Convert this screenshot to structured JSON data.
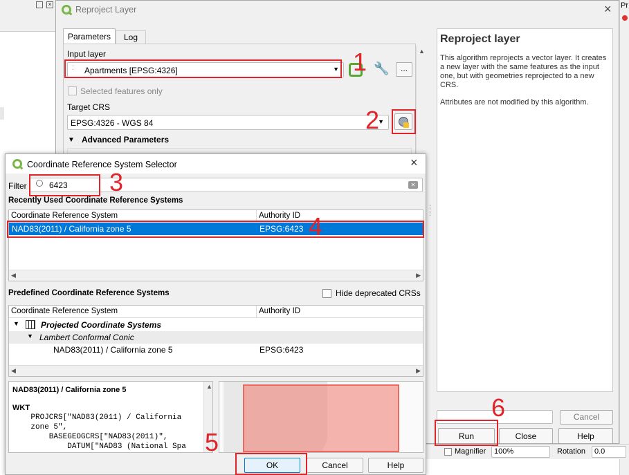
{
  "reproject": {
    "title": "Reproject Layer",
    "tabs": [
      "Parameters",
      "Log"
    ],
    "input_layer_label": "Input layer",
    "input_layer_value": "Apartments [EPSG:4326]",
    "selected_only": "Selected features only",
    "target_crs_label": "Target CRS",
    "target_crs_value": "EPSG:4326 - WGS 84",
    "advanced": "Advanced Parameters",
    "ellipsis": "...",
    "help_title": "Reproject layer",
    "help_p1": "This algorithm reprojects a vector layer. It creates a new layer with the same features as the input one, but with geometries reprojected to a new CRS.",
    "help_p2": "Attributes are not modified by this algorithm.",
    "cancel": "Cancel",
    "run": "Run",
    "close": "Close",
    "help": "Help"
  },
  "crs": {
    "title": "Coordinate Reference System Selector",
    "filter_label": "Filter",
    "filter_value": "6423",
    "recent_title": "Recently Used Coordinate Reference Systems",
    "col_crs": "Coordinate Reference System",
    "col_auth": "Authority ID",
    "recent_row": {
      "name": "NAD83(2011) / California zone 5",
      "auth": "EPSG:6423"
    },
    "predefined_title": "Predefined Coordinate Reference Systems",
    "hide_deprecated": "Hide deprecated CRSs",
    "tree_projected": "Projected Coordinate Systems",
    "tree_lcc": "Lambert Conformal Conic",
    "tree_item": {
      "name": "NAD83(2011) / California zone 5",
      "auth": "EPSG:6423"
    },
    "desc_title": "NAD83(2011) / California zone 5",
    "wkt_label": "WKT",
    "wkt_lines": [
      "    PROJCRS[\"NAD83(2011) / California",
      "    zone 5\",",
      "        BASEGEOGCRS[\"NAD83(2011)\",",
      "            DATUM[\"NAD83 (National Spa"
    ],
    "ok": "OK",
    "cancel": "Cancel",
    "help": "Help"
  },
  "annotations": [
    "1",
    "2",
    "3",
    "4",
    "5",
    "6"
  ],
  "background": {
    "pr": "Pr",
    "magnifier": "Magnifier",
    "zoom": "100%",
    "rotation": "Rotation",
    "rotation_val": "0.0"
  },
  "colors": {
    "annotation_red": "#e0242b",
    "selection_blue": "#0078d7",
    "extent_fill": "#f0a6a2",
    "qgis_green": "#7ab648"
  }
}
